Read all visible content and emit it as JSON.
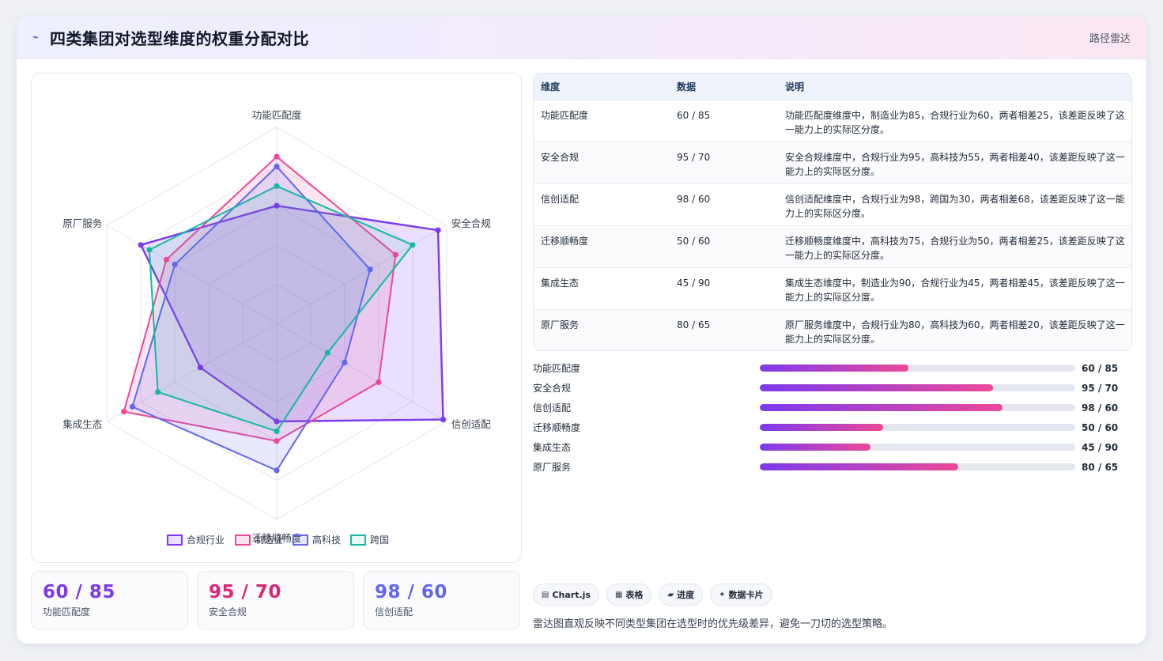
{
  "header": {
    "title": "四类集团对选型维度的权重分配对比",
    "right_text": "路径雷达",
    "icon": "pulse-icon"
  },
  "chart_data": {
    "type": "radar",
    "axes": [
      "功能匹配度",
      "安全合规",
      "信创适配",
      "迁移顺畅度",
      "集成生态",
      "原厂服务"
    ],
    "range": [
      0,
      100
    ],
    "grid": true,
    "legend_position": "bottom",
    "series": [
      {
        "name": "合规行业",
        "color": "#7c3aed",
        "values": [
          60,
          95,
          98,
          50,
          45,
          80
        ]
      },
      {
        "name": "制造业",
        "color": "#ec4899",
        "values": [
          85,
          70,
          60,
          60,
          90,
          65
        ]
      },
      {
        "name": "高科技",
        "color": "#6366f1",
        "values": [
          80,
          55,
          40,
          75,
          85,
          60
        ]
      },
      {
        "name": "跨国",
        "color": "#14b8a6",
        "values": [
          70,
          80,
          30,
          55,
          70,
          75
        ]
      }
    ]
  },
  "stats": [
    {
      "value": "60 / 85",
      "label": "功能匹配度",
      "color": "#7c3aed"
    },
    {
      "value": "95 / 70",
      "label": "安全合规",
      "color": "#db2777"
    },
    {
      "value": "98 / 60",
      "label": "信创适配",
      "color": "#6366f1"
    }
  ],
  "table": {
    "headers": [
      "维度",
      "数据",
      "说明"
    ],
    "rows": [
      {
        "dim": "功能匹配度",
        "data": "60 / 85",
        "desc": "功能匹配度维度中，制造业为85，合规行业为60，两者相差25，该差距反映了这一能力上的实际区分度。"
      },
      {
        "dim": "安全合规",
        "data": "95 / 70",
        "desc": "安全合规维度中，合规行业为95，高科技为55，两者相差40，该差距反映了这一能力上的实际区分度。"
      },
      {
        "dim": "信创适配",
        "data": "98 / 60",
        "desc": "信创适配维度中，合规行业为98，跨国为30，两者相差68，该差距反映了这一能力上的实际区分度。"
      },
      {
        "dim": "迁移顺畅度",
        "data": "50 / 60",
        "desc": "迁移顺畅度维度中，高科技为75，合规行业为50，两者相差25，该差距反映了这一能力上的实际区分度。"
      },
      {
        "dim": "集成生态",
        "data": "45 / 90",
        "desc": "集成生态维度中，制造业为90，合规行业为45，两者相差45，该差距反映了这一能力上的实际区分度。"
      },
      {
        "dim": "原厂服务",
        "data": "80 / 65",
        "desc": "原厂服务维度中，合规行业为80，高科技为60，两者相差20，该差距反映了这一能力上的实际区分度。"
      }
    ]
  },
  "bars": [
    {
      "label": "功能匹配度",
      "value": "60 / 85",
      "fill_pct": 47
    },
    {
      "label": "安全合规",
      "value": "95 / 70",
      "fill_pct": 74
    },
    {
      "label": "信创适配",
      "value": "98 / 60",
      "fill_pct": 77
    },
    {
      "label": "迁移顺畅度",
      "value": "50 / 60",
      "fill_pct": 39
    },
    {
      "label": "集成生态",
      "value": "45 / 90",
      "fill_pct": 35
    },
    {
      "label": "原厂服务",
      "value": "80 / 65",
      "fill_pct": 63
    }
  ],
  "chips": [
    {
      "icon": "chart-icon",
      "glyph": "▤",
      "label": "Chart.js"
    },
    {
      "icon": "table-icon",
      "glyph": "▦",
      "label": "表格"
    },
    {
      "icon": "progress-icon",
      "glyph": "▰",
      "label": "进度"
    },
    {
      "icon": "sparkle-icon",
      "glyph": "✦",
      "label": "数据卡片"
    }
  ],
  "footnote": "雷达图直观反映不同类型集团在选型时的优先级差异，避免一刀切的选型策略。"
}
